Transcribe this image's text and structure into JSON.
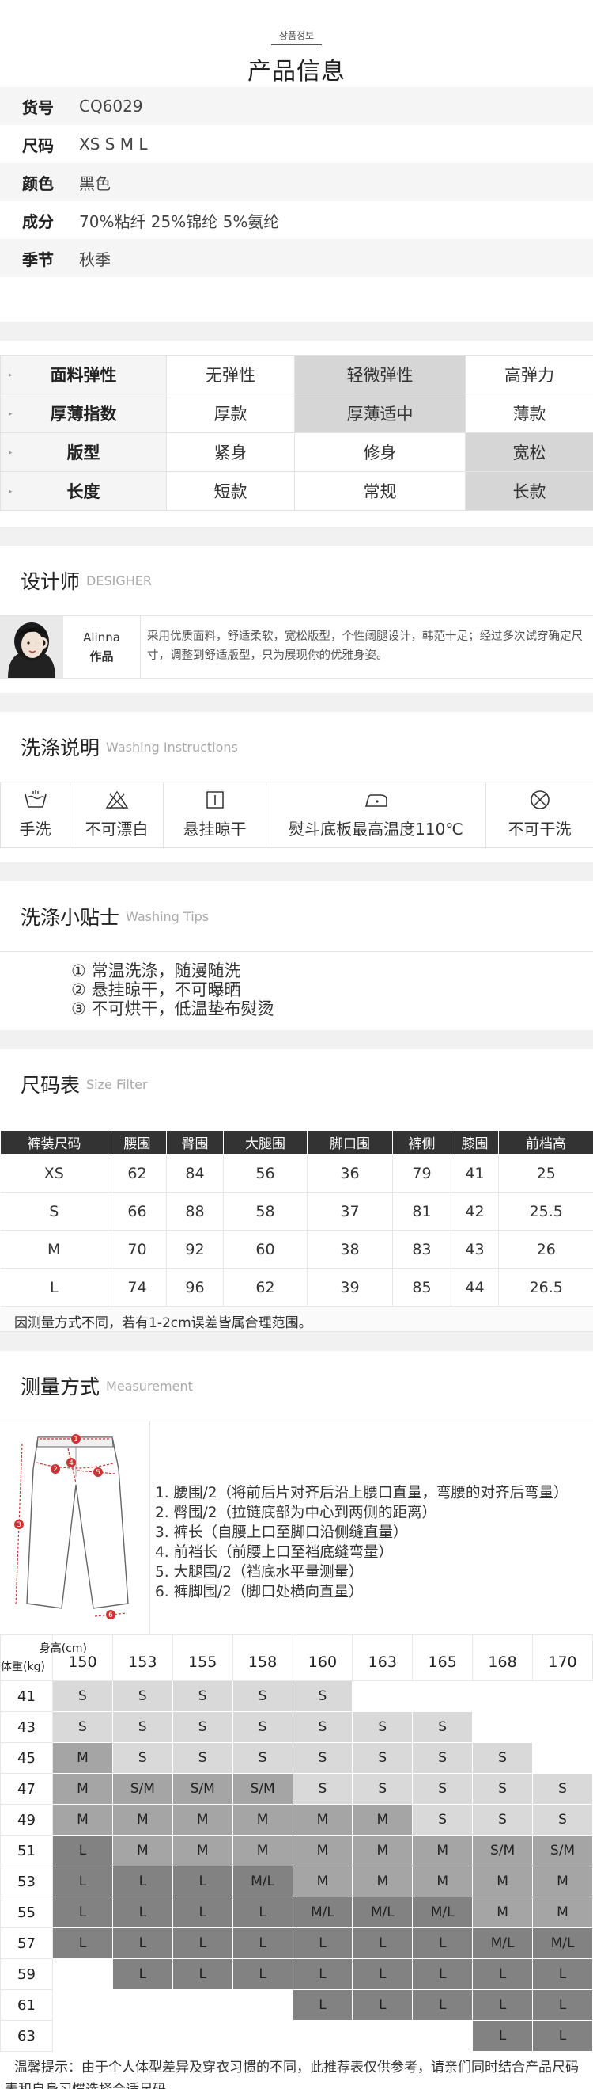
{
  "header": {
    "sub": "상품정보",
    "title": "产品信息"
  },
  "info": [
    {
      "k": "货号",
      "v": "CQ6029"
    },
    {
      "k": "尺码",
      "v": "XS S M L"
    },
    {
      "k": "颜色",
      "v": "黑色"
    },
    {
      "k": "成分",
      "v": "70%粘纤 25%锦纶 5%氨纶"
    },
    {
      "k": "季节",
      "v": "秋季"
    }
  ],
  "attributes": [
    {
      "label": "面料弹性",
      "options": [
        "无弹性",
        "轻微弹性",
        "高弹力"
      ],
      "selected": 1
    },
    {
      "label": "厚薄指数",
      "options": [
        "厚款",
        "厚薄适中",
        "薄款"
      ],
      "selected": 1
    },
    {
      "label": "版型",
      "options": [
        "紧身",
        "修身",
        "宽松"
      ],
      "selected": 2
    },
    {
      "label": "长度",
      "options": [
        "短款",
        "常规",
        "长款"
      ],
      "selected": 2
    }
  ],
  "designer": {
    "title": "设计师",
    "title_en": "DESIGHER",
    "name": "Alinna",
    "works": "作品",
    "desc": "采用优质面料，舒适柔软，宽松版型，个性阔腿设计，韩范十足；经过多次试穿确定尺寸，调整到舒适版型，只为展现你的优雅身姿。"
  },
  "washing": {
    "title": "洗涤说明",
    "title_en": "Washing Instructions",
    "items": [
      {
        "icon": "hand-wash-icon",
        "text": "手洗"
      },
      {
        "icon": "no-bleach-icon",
        "text": "不可漂白"
      },
      {
        "icon": "hang-dry-icon",
        "text": "悬挂晾干"
      },
      {
        "icon": "iron-icon",
        "text": "熨斗底板最高温度110℃"
      },
      {
        "icon": "no-tumble-dry-icon",
        "text": "不可干洗"
      }
    ]
  },
  "tips": {
    "title": "洗涤小贴士",
    "title_en": "Washing Tips",
    "items": [
      "① 常温洗涤，随漫随洗",
      "② 悬挂晾干，不可曝晒",
      "③ 不可烘干，低温垫布熨烫"
    ]
  },
  "size_table": {
    "title": "尺码表",
    "title_en": "Size Filter",
    "headers": [
      "裤装尺码",
      "腰围",
      "臀围",
      "大腿围",
      "脚口围",
      "裤侧",
      "膝围",
      "前档高"
    ],
    "rows": [
      [
        "XS",
        "62",
        "84",
        "56",
        "36",
        "79",
        "41",
        "25"
      ],
      [
        "S",
        "66",
        "88",
        "58",
        "37",
        "81",
        "42",
        "25.5"
      ],
      [
        "M",
        "70",
        "92",
        "60",
        "38",
        "83",
        "43",
        "26"
      ],
      [
        "L",
        "74",
        "96",
        "62",
        "39",
        "85",
        "44",
        "26.5"
      ]
    ],
    "note": "因测量方式不同，若有1-2cm误差皆属合理范围。"
  },
  "measurement": {
    "title": "测量方式",
    "title_en": "Measurement",
    "items": [
      "1. 腰围/2（将前后片对齐后沿上腰口直量，弯腰的对齐后弯量）",
      "2. 臀围/2（拉链底部为中心到两侧的距离）",
      "3. 裤长（自腰上口至脚口沿侧缝直量）",
      "4. 前裆长（前腰上口至裆底缝弯量）",
      "5. 大腿围/2（裆底水平量测量）",
      "6. 裤脚围/2（脚口处横向直量）"
    ],
    "markers": [
      "1",
      "2",
      "3",
      "4",
      "5",
      "6"
    ]
  },
  "size_grid": {
    "height_label": "身高(cm)",
    "weight_label": "体重(kg)",
    "heights": [
      "150",
      "153",
      "155",
      "158",
      "160",
      "163",
      "165",
      "168",
      "170"
    ],
    "rows": [
      {
        "w": "41",
        "cells": [
          [
            "S",
            1
          ],
          [
            "S",
            1
          ],
          [
            "S",
            1
          ],
          [
            "S",
            1
          ],
          [
            "S",
            1
          ],
          [
            "",
            0
          ],
          [
            "",
            0
          ],
          [
            "",
            0
          ],
          [
            "",
            0
          ]
        ]
      },
      {
        "w": "43",
        "cells": [
          [
            "S",
            1
          ],
          [
            "S",
            1
          ],
          [
            "S",
            1
          ],
          [
            "S",
            1
          ],
          [
            "S",
            1
          ],
          [
            "S",
            1
          ],
          [
            "S",
            1
          ],
          [
            "",
            0
          ],
          [
            "",
            0
          ]
        ]
      },
      {
        "w": "45",
        "cells": [
          [
            "M",
            2
          ],
          [
            "S",
            1
          ],
          [
            "S",
            1
          ],
          [
            "S",
            1
          ],
          [
            "S",
            1
          ],
          [
            "S",
            1
          ],
          [
            "S",
            1
          ],
          [
            "S",
            1
          ],
          [
            "",
            0
          ]
        ]
      },
      {
        "w": "47",
        "cells": [
          [
            "M",
            2
          ],
          [
            "S/M",
            2
          ],
          [
            "S/M",
            2
          ],
          [
            "S/M",
            2
          ],
          [
            "S",
            1
          ],
          [
            "S",
            1
          ],
          [
            "S",
            1
          ],
          [
            "S",
            1
          ],
          [
            "S",
            1
          ]
        ]
      },
      {
        "w": "49",
        "cells": [
          [
            "M",
            2
          ],
          [
            "M",
            2
          ],
          [
            "M",
            2
          ],
          [
            "M",
            2
          ],
          [
            "M",
            2
          ],
          [
            "M",
            2
          ],
          [
            "S",
            1
          ],
          [
            "S",
            1
          ],
          [
            "S",
            1
          ]
        ]
      },
      {
        "w": "51",
        "cells": [
          [
            "L",
            3
          ],
          [
            "M",
            2
          ],
          [
            "M",
            2
          ],
          [
            "M",
            2
          ],
          [
            "M",
            2
          ],
          [
            "M",
            2
          ],
          [
            "M",
            2
          ],
          [
            "S/M",
            2
          ],
          [
            "S/M",
            2
          ]
        ]
      },
      {
        "w": "53",
        "cells": [
          [
            "L",
            3
          ],
          [
            "L",
            3
          ],
          [
            "L",
            3
          ],
          [
            "M/L",
            3
          ],
          [
            "M",
            2
          ],
          [
            "M",
            2
          ],
          [
            "M",
            2
          ],
          [
            "M",
            2
          ],
          [
            "M",
            2
          ]
        ]
      },
      {
        "w": "55",
        "cells": [
          [
            "L",
            3
          ],
          [
            "L",
            3
          ],
          [
            "L",
            3
          ],
          [
            "L",
            3
          ],
          [
            "M/L",
            3
          ],
          [
            "M/L",
            3
          ],
          [
            "M/L",
            3
          ],
          [
            "M",
            2
          ],
          [
            "M",
            2
          ]
        ]
      },
      {
        "w": "57",
        "cells": [
          [
            "L",
            3
          ],
          [
            "L",
            3
          ],
          [
            "L",
            3
          ],
          [
            "L",
            3
          ],
          [
            "L",
            3
          ],
          [
            "L",
            3
          ],
          [
            "L",
            3
          ],
          [
            "M/L",
            3
          ],
          [
            "M/L",
            3
          ]
        ]
      },
      {
        "w": "59",
        "cells": [
          [
            "",
            0
          ],
          [
            "L",
            3
          ],
          [
            "L",
            3
          ],
          [
            "L",
            3
          ],
          [
            "L",
            3
          ],
          [
            "L",
            3
          ],
          [
            "L",
            3
          ],
          [
            "L",
            3
          ],
          [
            "L",
            3
          ]
        ]
      },
      {
        "w": "61",
        "cells": [
          [
            "",
            0
          ],
          [
            "",
            0
          ],
          [
            "",
            0
          ],
          [
            "",
            0
          ],
          [
            "L",
            3
          ],
          [
            "L",
            3
          ],
          [
            "L",
            3
          ],
          [
            "L",
            3
          ],
          [
            "L",
            3
          ]
        ]
      },
      {
        "w": "63",
        "cells": [
          [
            "",
            0
          ],
          [
            "",
            0
          ],
          [
            "",
            0
          ],
          [
            "",
            0
          ],
          [
            "",
            0
          ],
          [
            "",
            0
          ],
          [
            "",
            0
          ],
          [
            "L",
            3
          ],
          [
            "L",
            3
          ]
        ]
      }
    ],
    "warm_tip": "温馨提示：由于个人体型差异及穿衣习惯的不同，此推荐表仅供参考，请亲们同时结合产品尺码表和自身习惯选择合适尺码。"
  }
}
